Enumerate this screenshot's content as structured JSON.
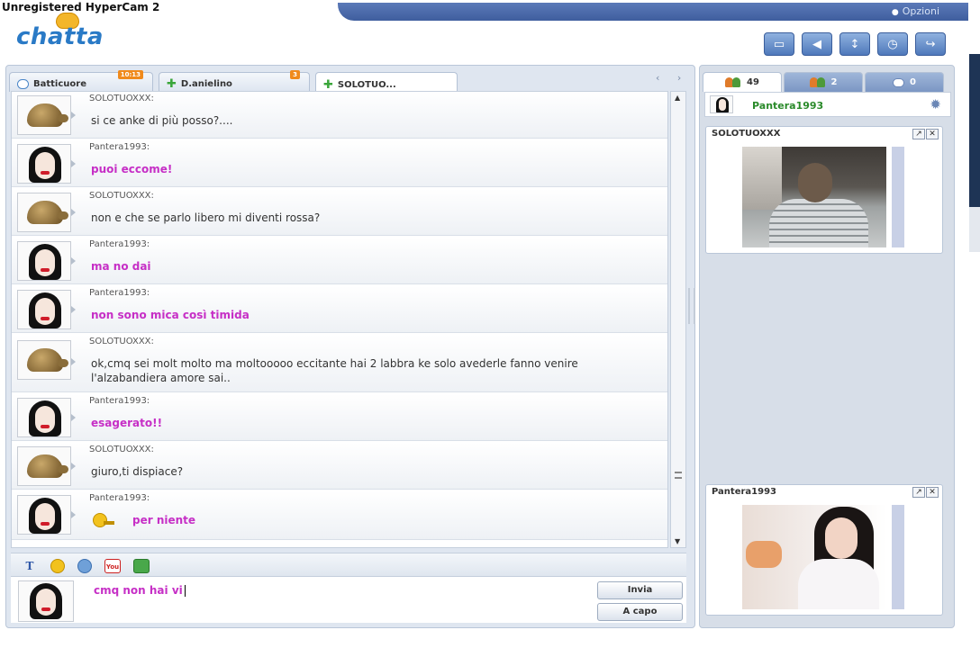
{
  "watermark": "Unregistered HyperCam 2",
  "header": {
    "logo": "chatta",
    "options_label": "Opzioni",
    "buttons": [
      "gamepad",
      "speaker",
      "updown",
      "history",
      "logout"
    ]
  },
  "chat_tabs": [
    {
      "label": "Batticuore",
      "badge": "10:13"
    },
    {
      "label": "D.anielino",
      "badge": "3"
    },
    {
      "label": "SOLOTUO...",
      "badge": ""
    }
  ],
  "messages": [
    {
      "nick": "SOLOTUOXXX:",
      "text": "si ce anke di più posso?....",
      "style": "normal",
      "avatar": "turtle"
    },
    {
      "nick": "Pantera1993:",
      "text": "puoi eccome!",
      "style": "pink",
      "avatar": "girl"
    },
    {
      "nick": "SOLOTUOXXX:",
      "text": "non e che se parlo libero mi diventi rossa?",
      "style": "normal",
      "avatar": "turtle"
    },
    {
      "nick": "Pantera1993:",
      "text": "ma no dai",
      "style": "pink",
      "avatar": "girl"
    },
    {
      "nick": "Pantera1993:",
      "text": "non sono mica così timida",
      "style": "pink",
      "avatar": "girl"
    },
    {
      "nick": "SOLOTUOXXX:",
      "text": "ok,cmq sei molt molto ma moltooooo eccitante hai 2 labbra ke solo avederle fanno venire l'alzabandiera amore sai..",
      "style": "normal",
      "avatar": "turtle"
    },
    {
      "nick": "Pantera1993:",
      "text": "esagerato!!",
      "style": "pink",
      "avatar": "girl"
    },
    {
      "nick": "SOLOTUOXXX:",
      "text": "giuro,ti dispiace?",
      "style": "normal",
      "avatar": "turtle"
    },
    {
      "nick": "Pantera1993:",
      "text": "per niente",
      "style": "pink",
      "avatar": "girl"
    }
  ],
  "format_toolbar": [
    "text-format",
    "emoticons",
    "winks",
    "youtube",
    "games"
  ],
  "input": {
    "value": "cmq non hai vi",
    "send_label": "Invia",
    "newline_label": "A capo"
  },
  "right_tabs": [
    {
      "icon": "users",
      "count": "49"
    },
    {
      "icon": "friends",
      "count": "2"
    },
    {
      "icon": "messages",
      "count": "0"
    }
  ],
  "current_user": "Pantera1993",
  "cams": [
    {
      "title": "SOLOTUOXXX"
    },
    {
      "title": "Pantera1993"
    }
  ],
  "colors": {
    "accent": "#4f79bb",
    "own_message": "#c62fc6",
    "username_online": "#2a8a2a"
  }
}
